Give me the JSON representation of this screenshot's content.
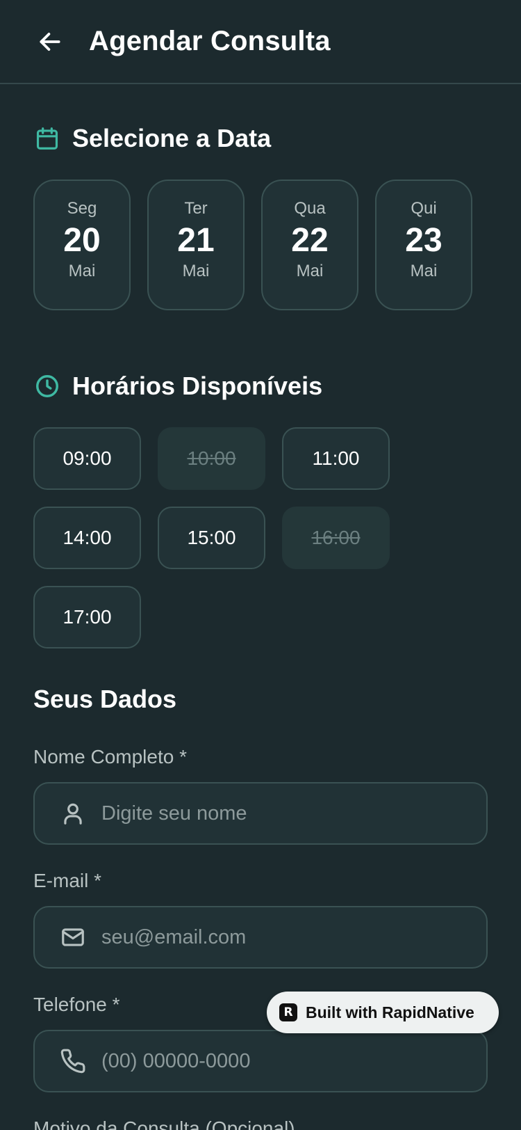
{
  "header": {
    "title": "Agendar Consulta",
    "back_icon": "arrow-left-icon"
  },
  "date_section": {
    "title": "Selecione a Data",
    "icon": "calendar-icon",
    "dates": [
      {
        "weekday": "Seg",
        "day": "20",
        "month": "Mai"
      },
      {
        "weekday": "Ter",
        "day": "21",
        "month": "Mai"
      },
      {
        "weekday": "Qua",
        "day": "22",
        "month": "Mai"
      },
      {
        "weekday": "Qui",
        "day": "23",
        "month": "Mai"
      }
    ]
  },
  "time_section": {
    "title": "Horários Disponíveis",
    "icon": "clock-icon",
    "slots": [
      {
        "time": "09:00",
        "available": true
      },
      {
        "time": "10:00",
        "available": false
      },
      {
        "time": "11:00",
        "available": true
      },
      {
        "time": "14:00",
        "available": true
      },
      {
        "time": "15:00",
        "available": true
      },
      {
        "time": "16:00",
        "available": false
      },
      {
        "time": "17:00",
        "available": true
      }
    ]
  },
  "form": {
    "title": "Seus Dados",
    "name": {
      "label": "Nome Completo *",
      "placeholder": "Digite seu nome",
      "value": ""
    },
    "email": {
      "label": "E-mail *",
      "placeholder": "seu@email.com",
      "value": ""
    },
    "phone": {
      "label": "Telefone *",
      "placeholder": "(00) 00000-0000",
      "value": ""
    },
    "reason": {
      "label": "Motivo da Consulta (Opcional)"
    }
  },
  "badge": {
    "label": "Built with RapidNative"
  },
  "colors": {
    "background": "#1c2a2e",
    "card": "#213236",
    "border": "#3a5253",
    "accent": "#3fb9a3",
    "muted_text": "#b8c2c2"
  }
}
